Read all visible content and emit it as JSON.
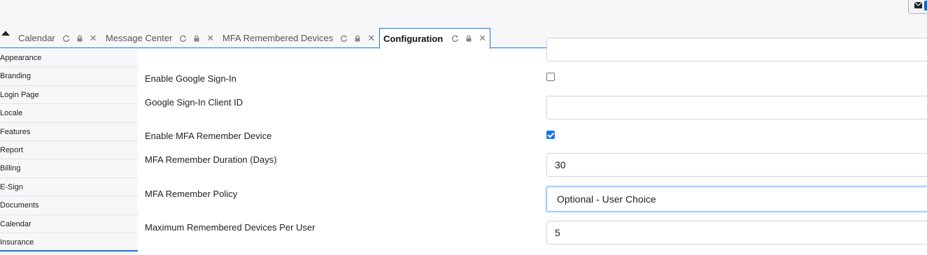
{
  "header": {
    "mail_icon": "envelope-icon"
  },
  "tabs": [
    {
      "label": "Calendar",
      "icons": [
        "refresh-icon",
        "lock-icon",
        "close-icon"
      ]
    },
    {
      "label": "Message Center",
      "icons": [
        "refresh-icon",
        "lock-icon",
        "close-icon"
      ]
    },
    {
      "label": "MFA Remembered Devices",
      "icons": [
        "refresh-icon",
        "lock-icon",
        "close-icon"
      ]
    },
    {
      "label": "Configuration",
      "icons": [
        "refresh-icon",
        "lock-icon",
        "close-icon"
      ],
      "active": true
    }
  ],
  "sidebar": {
    "items": [
      {
        "label": "Appearance"
      },
      {
        "label": "Branding"
      },
      {
        "label": "Login Page"
      },
      {
        "label": "Locale"
      },
      {
        "label": "Features"
      },
      {
        "label": "Report"
      },
      {
        "label": "Billing"
      },
      {
        "label": "E-Sign"
      },
      {
        "label": "Documents"
      },
      {
        "label": "Calendar"
      },
      {
        "label": "Insurance"
      }
    ]
  },
  "form": {
    "google_signin_label": "Enable Google Sign-In",
    "google_signin_checked": false,
    "google_client_id_label": "Google Sign-In Client ID",
    "google_client_id_value": "",
    "mfa_remember_label": "Enable MFA Remember Device",
    "mfa_remember_checked": true,
    "mfa_duration_label": "MFA Remember Duration (Days)",
    "mfa_duration_value": "30",
    "mfa_policy_label": "MFA Remember Policy",
    "mfa_policy_value": "Optional - User Choice",
    "max_devices_label": "Maximum Remembered Devices Per User",
    "max_devices_value": "5"
  },
  "colors": {
    "accent": "#1a73e8",
    "sidebar_bg": "#f7f7f9"
  }
}
